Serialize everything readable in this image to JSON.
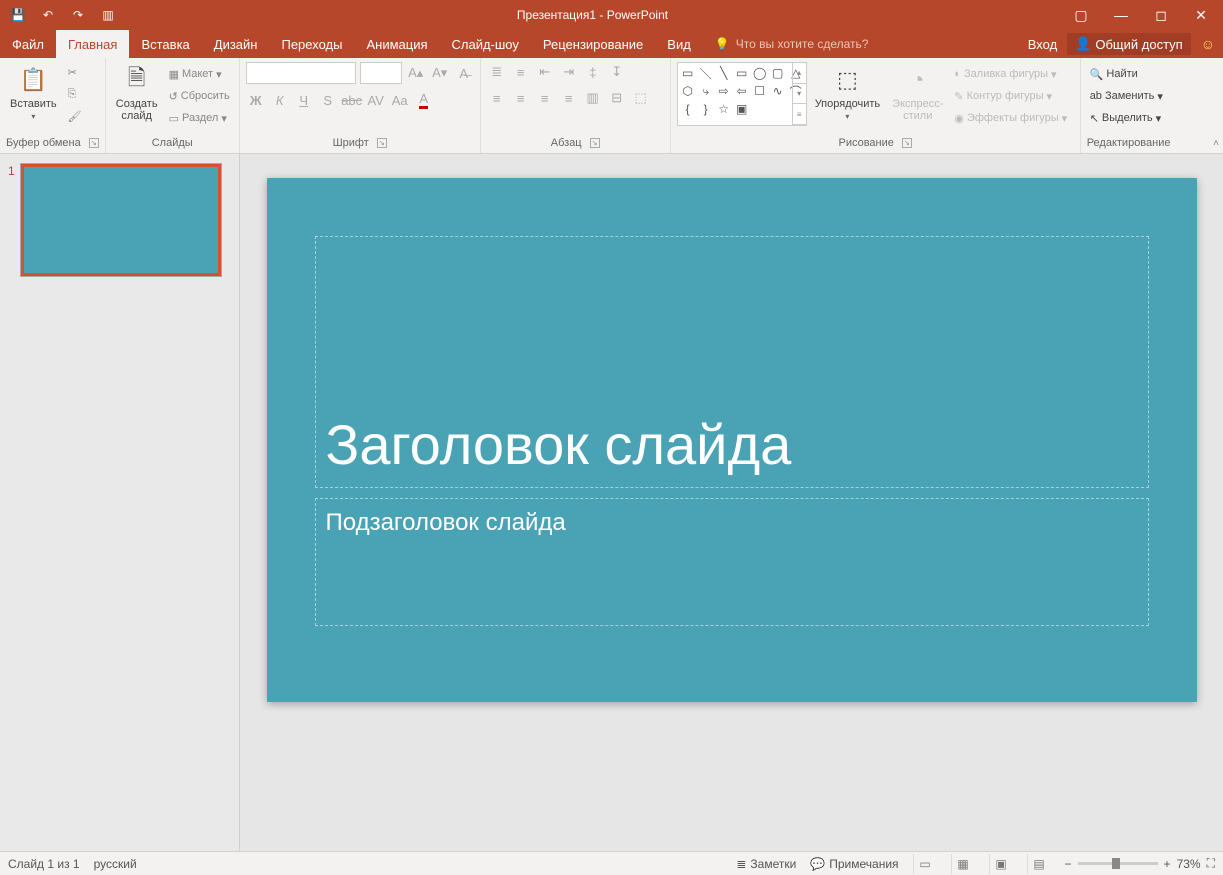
{
  "title": "Презентация1 - PowerPoint",
  "tabs": {
    "file": "Файл",
    "home": "Главная",
    "insert": "Вставка",
    "design": "Дизайн",
    "transitions": "Переходы",
    "animations": "Анимация",
    "slideshow": "Слайд-шоу",
    "review": "Рецензирование",
    "view": "Вид"
  },
  "tellme": "Что вы хотите сделать?",
  "signin": "Вход",
  "share": "Общий доступ",
  "groups": {
    "clipboard": {
      "label": "Буфер обмена",
      "paste": "Вставить"
    },
    "slides": {
      "label": "Слайды",
      "newslide": "Создать\nслайд",
      "layout": "Макет",
      "reset": "Сбросить",
      "section": "Раздел"
    },
    "font": {
      "label": "Шрифт"
    },
    "paragraph": {
      "label": "Абзац"
    },
    "drawing": {
      "label": "Рисование",
      "arrange": "Упорядочить",
      "styles": "Экспресс-\nстили",
      "fill": "Заливка фигуры",
      "outline": "Контур фигуры",
      "effects": "Эффекты фигуры"
    },
    "editing": {
      "label": "Редактирование",
      "find": "Найти",
      "replace": "Заменить",
      "select": "Выделить"
    }
  },
  "thumb": {
    "num": "1"
  },
  "slide": {
    "title": "Заголовок слайда",
    "subtitle": "Подзаголовок слайда"
  },
  "status": {
    "slideinfo": "Слайд 1 из 1",
    "lang": "русский",
    "notes": "Заметки",
    "comments": "Примечания",
    "zoom": "73%"
  }
}
